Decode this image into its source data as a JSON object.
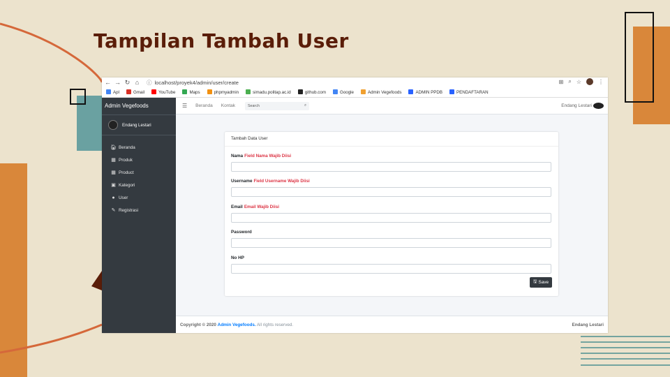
{
  "slide": {
    "title": "Tampilan Tambah User"
  },
  "colors": {
    "accent_orange": "#d9873a",
    "teal": "#6aa1a1",
    "dark_brown": "#5a1d08",
    "arc": "#d5683a",
    "sidebar": "#343a40",
    "error_red": "#dc3545",
    "link_blue": "#007bff"
  },
  "browser": {
    "url": "localhost/proyek4/admin/user/create",
    "bookmarks": [
      {
        "label": "Apl",
        "icon": "apps-grid-icon",
        "color": "#4285f4"
      },
      {
        "label": "Gmail",
        "icon": "gmail-icon",
        "color": "#d93025"
      },
      {
        "label": "YouTube",
        "icon": "youtube-icon",
        "color": "#ff0000"
      },
      {
        "label": "Maps",
        "icon": "maps-icon",
        "color": "#34a853"
      },
      {
        "label": "phpmyadmin",
        "icon": "phpmyadmin-icon",
        "color": "#f29111"
      },
      {
        "label": "simadu.politap.ac.id",
        "icon": "simadu-icon",
        "color": "#4caf50"
      },
      {
        "label": "github.com",
        "icon": "github-icon",
        "color": "#222222"
      },
      {
        "label": "Google",
        "icon": "google-icon",
        "color": "#4285f4"
      },
      {
        "label": "Admin Vegefoods",
        "icon": "vegefoods-icon",
        "color": "#f0a030"
      },
      {
        "label": "ADMIN PPDB",
        "icon": "ppdb-icon",
        "color": "#2962ff"
      },
      {
        "label": "PENDAFTARAN",
        "icon": "pendaftaran-icon",
        "color": "#2962ff"
      }
    ]
  },
  "sidebar": {
    "brand": "Admin Vegefoods",
    "user_name": "Endang Lestari",
    "items": [
      {
        "label": "Beranda",
        "icon": "home-icon"
      },
      {
        "label": "Produk",
        "icon": "calendar-icon"
      },
      {
        "label": "Product",
        "icon": "calendar-icon"
      },
      {
        "label": "Kategori",
        "icon": "image-icon"
      },
      {
        "label": "User",
        "icon": "user-icon"
      },
      {
        "label": "Registrasi",
        "icon": "edit-icon"
      }
    ]
  },
  "topbar": {
    "links": [
      "Beranda",
      "Kontak"
    ],
    "search_placeholder": "Search",
    "user_name": "Endang Lestari"
  },
  "form": {
    "card_title": "Tambah Data User",
    "fields": [
      {
        "label": "Nama",
        "error": "Field Nama Wajib Diisi",
        "value": ""
      },
      {
        "label": "Username",
        "error": "Field Username Wajib Diisi",
        "value": ""
      },
      {
        "label": "Email",
        "error": "Email Wajib Diisi",
        "value": ""
      },
      {
        "label": "Password",
        "error": "",
        "value": ""
      },
      {
        "label": "No HP",
        "error": "",
        "value": ""
      }
    ],
    "save_label": "Save"
  },
  "footer": {
    "prefix": "Copyright © 2020",
    "link": "Admin Vegefoods.",
    "suffix": "All rights reserved.",
    "right": "Endang Lestari"
  }
}
